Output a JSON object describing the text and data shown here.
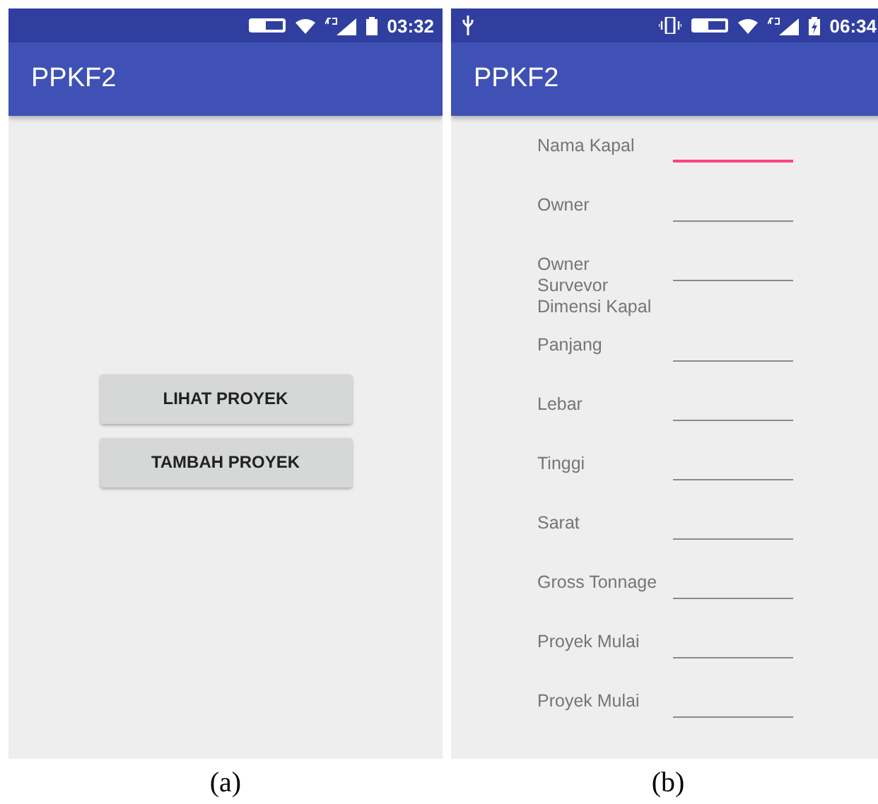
{
  "screens": [
    {
      "caption": "(a)",
      "status_bar": {
        "time": "03:32",
        "usb": false,
        "charging": false
      },
      "app_bar": {
        "title": "PPKF2"
      },
      "kind": "menu",
      "buttons": [
        "LIHAT PROYEK",
        "TAMBAH PROYEK"
      ]
    },
    {
      "caption": "(b)",
      "status_bar": {
        "time": "06:34",
        "usb": true,
        "charging": true
      },
      "app_bar": {
        "title": "PPKF2"
      },
      "kind": "form",
      "rows": [
        {
          "kind": "field",
          "label": "Nama Kapal",
          "selected": true
        },
        {
          "kind": "field",
          "label": "Owner",
          "selected": false
        },
        {
          "kind": "field",
          "label": "Owner\nSurvevor",
          "selected": false
        },
        {
          "kind": "heading",
          "label": "Dimensi Kapal"
        },
        {
          "kind": "field",
          "label": "Panjang",
          "selected": false
        },
        {
          "kind": "field",
          "label": "Lebar",
          "selected": false
        },
        {
          "kind": "field",
          "label": "Tinggi",
          "selected": false
        },
        {
          "kind": "field",
          "label": "Sarat",
          "selected": false
        },
        {
          "kind": "field",
          "label": "Gross Tonnage",
          "selected": false
        },
        {
          "kind": "field",
          "label": "Proyek Mulai",
          "selected": false
        },
        {
          "kind": "field",
          "label": "Proyek Mulai",
          "selected": false
        }
      ]
    }
  ]
}
